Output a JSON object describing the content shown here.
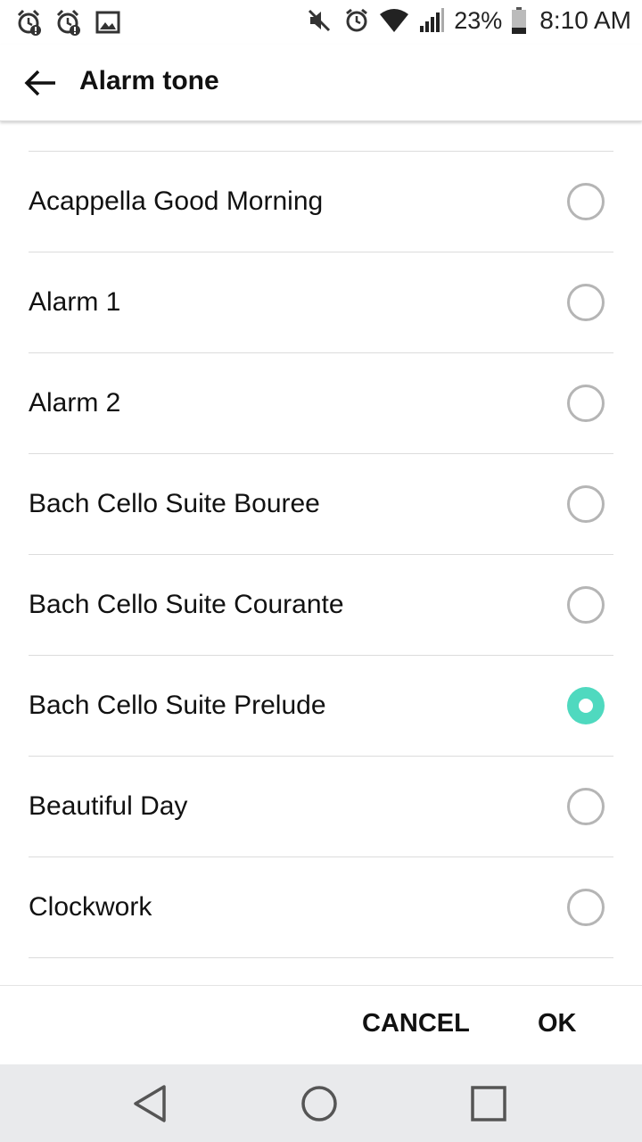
{
  "status_bar": {
    "left_icons": [
      "alarm-alert-icon",
      "alarm-alert-icon",
      "image-icon"
    ],
    "right_icons": [
      "mute-icon",
      "alarm-icon",
      "wifi-icon",
      "signal-icon",
      "battery-icon"
    ],
    "battery": "23%",
    "time": "8:10 AM"
  },
  "app_bar": {
    "title": "Alarm tone"
  },
  "tones": [
    {
      "label": "Acappella Good Morning",
      "selected": false
    },
    {
      "label": "Alarm 1",
      "selected": false
    },
    {
      "label": "Alarm 2",
      "selected": false
    },
    {
      "label": "Bach Cello Suite Bouree",
      "selected": false
    },
    {
      "label": "Bach Cello Suite Courante",
      "selected": false
    },
    {
      "label": "Bach Cello Suite Prelude",
      "selected": true
    },
    {
      "label": "Beautiful Day",
      "selected": false
    },
    {
      "label": "Clockwork",
      "selected": false
    }
  ],
  "buttons": {
    "cancel": "CANCEL",
    "ok": "OK"
  },
  "colors": {
    "accent": "#4fd9bf"
  }
}
